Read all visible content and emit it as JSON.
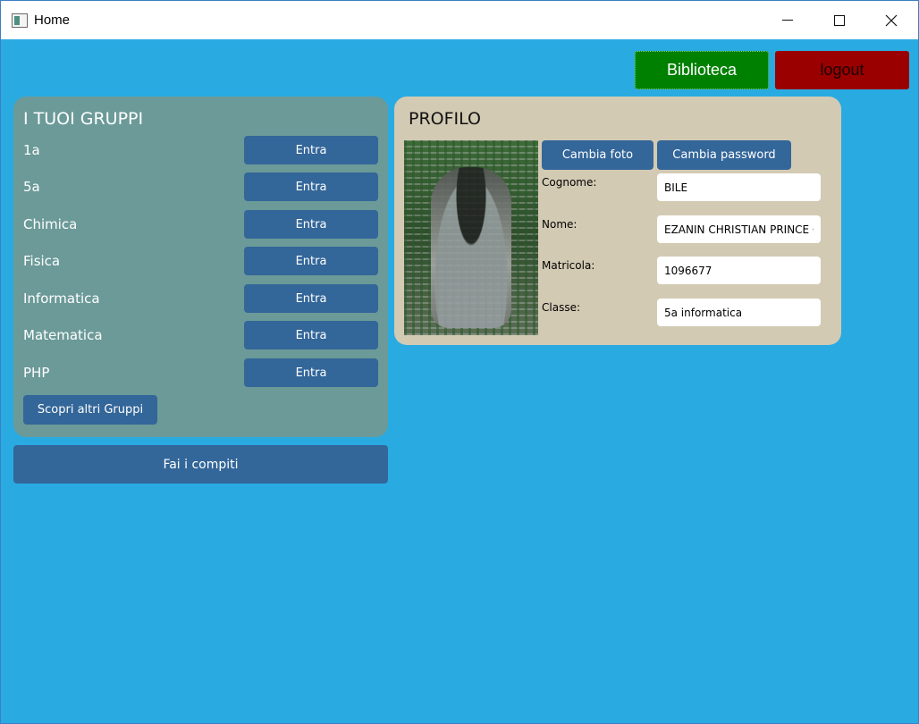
{
  "window": {
    "title": "Home",
    "icons": {
      "app": "app-window-icon",
      "minimize": "minimize-icon",
      "maximize": "maximize-icon",
      "close": "close-icon"
    }
  },
  "topbar": {
    "biblioteca_label": "Biblioteca",
    "logout_label": "logout",
    "colors": {
      "biblioteca": "#008000",
      "logout": "#9a0000"
    }
  },
  "gruppi": {
    "title": "I TUOI GRUPPI",
    "items": [
      {
        "name": "1a",
        "button": "Entra"
      },
      {
        "name": "5a",
        "button": "Entra"
      },
      {
        "name": "Chimica",
        "button": "Entra"
      },
      {
        "name": "Fisica",
        "button": "Entra"
      },
      {
        "name": "Informatica",
        "button": "Entra"
      },
      {
        "name": "Matematica",
        "button": "Entra"
      },
      {
        "name": "PHP",
        "button": "Entra"
      }
    ],
    "scopri_label": "Scopri altri Gruppi"
  },
  "compiti_label": "Fai i compiti",
  "profilo": {
    "title": "PROFILO",
    "cambia_foto_label": "Cambia foto",
    "cambia_password_label": "Cambia password",
    "fields": {
      "cognome": {
        "label": "Cognome:",
        "value": "BILE"
      },
      "nome": {
        "label": "Nome:",
        "value": "EZANIN CHRISTIAN PRINCE CA"
      },
      "matricola": {
        "label": "Matricola:",
        "value": "1096677"
      },
      "classe": {
        "label": "Classe:",
        "value": "5a informatica"
      }
    }
  },
  "colors": {
    "background": "#29abe2",
    "gruppi_panel": "#6b9a98",
    "profilo_panel": "#d3cab3",
    "button": "#336699"
  }
}
